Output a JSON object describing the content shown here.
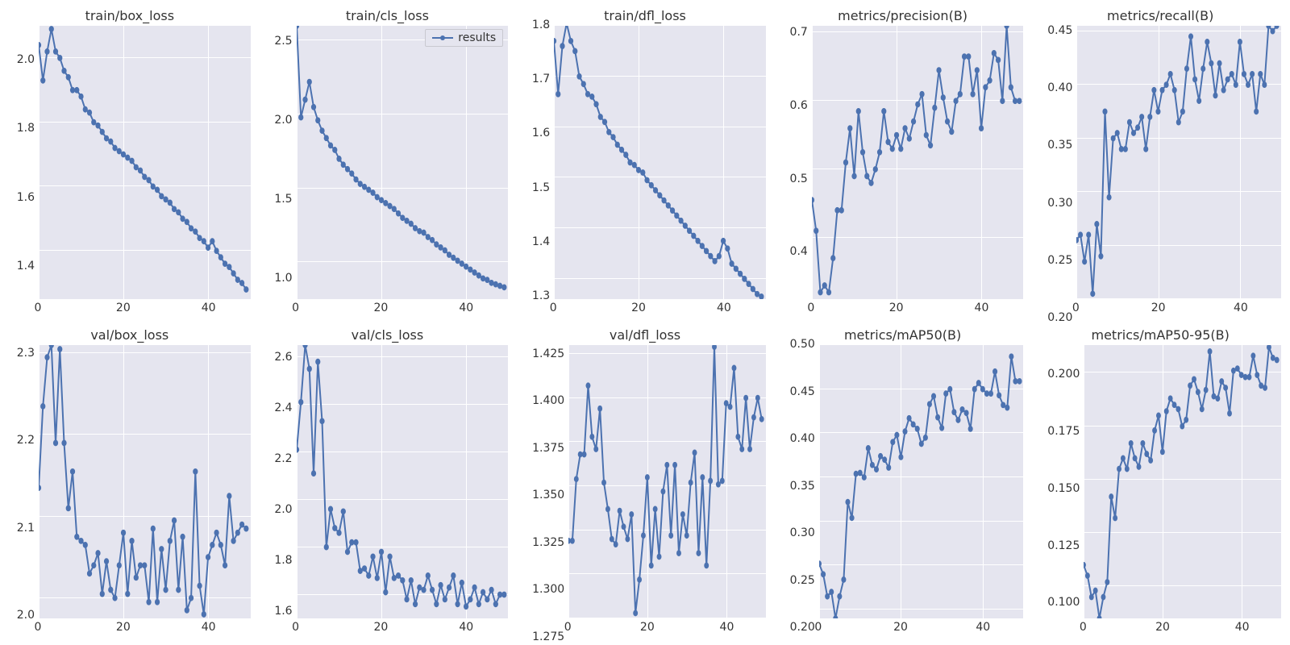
{
  "legend_label": "results",
  "chart_data": [
    {
      "id": "train_box_loss",
      "title": "train/box_loss",
      "type": "line",
      "xlabel": "",
      "ylabel": "",
      "xlim": [
        0,
        50
      ],
      "ylim": [
        1.25,
        2.1
      ],
      "xticks": [
        0,
        20,
        40
      ],
      "yticks": [
        1.4,
        1.6,
        1.8,
        2.0
      ],
      "legend_here": false,
      "values": [
        2.04,
        1.93,
        2.02,
        2.09,
        2.02,
        2.0,
        1.96,
        1.94,
        1.9,
        1.9,
        1.88,
        1.84,
        1.83,
        1.8,
        1.79,
        1.77,
        1.75,
        1.74,
        1.72,
        1.71,
        1.7,
        1.69,
        1.68,
        1.66,
        1.65,
        1.63,
        1.62,
        1.6,
        1.59,
        1.57,
        1.56,
        1.55,
        1.53,
        1.52,
        1.5,
        1.49,
        1.47,
        1.46,
        1.44,
        1.43,
        1.41,
        1.43,
        1.4,
        1.38,
        1.36,
        1.35,
        1.33,
        1.31,
        1.3,
        1.28
      ]
    },
    {
      "id": "train_cls_loss",
      "title": "train/cls_loss",
      "type": "line",
      "xlabel": "",
      "ylabel": "",
      "xlim": [
        0,
        50
      ],
      "ylim": [
        0.75,
        2.6
      ],
      "xticks": [
        0,
        20,
        40
      ],
      "yticks": [
        1.0,
        1.5,
        2.0,
        2.5
      ],
      "legend_here": true,
      "values": [
        2.6,
        1.98,
        2.1,
        2.22,
        2.05,
        1.96,
        1.89,
        1.84,
        1.79,
        1.76,
        1.7,
        1.66,
        1.63,
        1.6,
        1.56,
        1.53,
        1.51,
        1.49,
        1.47,
        1.44,
        1.42,
        1.4,
        1.38,
        1.36,
        1.33,
        1.3,
        1.28,
        1.26,
        1.23,
        1.21,
        1.2,
        1.17,
        1.15,
        1.12,
        1.1,
        1.08,
        1.05,
        1.03,
        1.01,
        0.99,
        0.97,
        0.95,
        0.93,
        0.91,
        0.89,
        0.88,
        0.86,
        0.85,
        0.84,
        0.83
      ]
    },
    {
      "id": "train_dfl_loss",
      "title": "train/dfl_loss",
      "type": "line",
      "xlabel": "",
      "ylabel": "",
      "xlim": [
        0,
        50
      ],
      "ylim": [
        1.26,
        1.8
      ],
      "xticks": [
        0,
        20,
        40
      ],
      "yticks": [
        1.3,
        1.4,
        1.5,
        1.6,
        1.7,
        1.8
      ],
      "legend_here": false,
      "values": [
        1.77,
        1.665,
        1.76,
        1.805,
        1.77,
        1.75,
        1.7,
        1.685,
        1.665,
        1.66,
        1.645,
        1.62,
        1.61,
        1.59,
        1.58,
        1.565,
        1.555,
        1.545,
        1.53,
        1.525,
        1.515,
        1.51,
        1.495,
        1.485,
        1.475,
        1.465,
        1.455,
        1.445,
        1.435,
        1.425,
        1.415,
        1.405,
        1.395,
        1.385,
        1.375,
        1.365,
        1.355,
        1.345,
        1.335,
        1.345,
        1.375,
        1.36,
        1.33,
        1.32,
        1.31,
        1.3,
        1.29,
        1.28,
        1.27,
        1.265
      ]
    },
    {
      "id": "metrics_precision",
      "title": "metrics/precision(B)",
      "type": "line",
      "xlabel": "",
      "ylabel": "",
      "xlim": [
        0,
        50
      ],
      "ylim": [
        0.31,
        0.71
      ],
      "xticks": [
        0,
        20,
        40
      ],
      "yticks": [
        0.4,
        0.5,
        0.6,
        0.7
      ],
      "legend_here": false,
      "values": [
        0.455,
        0.41,
        0.32,
        0.33,
        0.32,
        0.37,
        0.44,
        0.44,
        0.51,
        0.56,
        0.49,
        0.585,
        0.525,
        0.49,
        0.48,
        0.5,
        0.525,
        0.585,
        0.54,
        0.53,
        0.55,
        0.53,
        0.56,
        0.545,
        0.57,
        0.595,
        0.61,
        0.55,
        0.535,
        0.59,
        0.645,
        0.605,
        0.57,
        0.555,
        0.6,
        0.61,
        0.665,
        0.665,
        0.61,
        0.645,
        0.56,
        0.62,
        0.63,
        0.67,
        0.66,
        0.6,
        0.71,
        0.62,
        0.6,
        0.6
      ]
    },
    {
      "id": "metrics_recall",
      "title": "metrics/recall(B)",
      "type": "line",
      "xlabel": "",
      "ylabel": "",
      "xlim": [
        0,
        50
      ],
      "ylim": [
        0.2,
        0.455
      ],
      "xticks": [
        0,
        20,
        40
      ],
      "yticks": [
        0.2,
        0.25,
        0.3,
        0.35,
        0.4,
        0.45
      ],
      "legend_here": false,
      "values": [
        0.255,
        0.26,
        0.235,
        0.26,
        0.205,
        0.27,
        0.24,
        0.375,
        0.295,
        0.35,
        0.355,
        0.34,
        0.34,
        0.365,
        0.355,
        0.36,
        0.37,
        0.34,
        0.37,
        0.395,
        0.375,
        0.395,
        0.4,
        0.41,
        0.395,
        0.365,
        0.375,
        0.415,
        0.445,
        0.405,
        0.385,
        0.415,
        0.44,
        0.42,
        0.39,
        0.42,
        0.395,
        0.405,
        0.41,
        0.4,
        0.44,
        0.41,
        0.4,
        0.41,
        0.375,
        0.41,
        0.4,
        0.455,
        0.45,
        0.455
      ]
    },
    {
      "id": "val_box_loss",
      "title": "val/box_loss",
      "type": "line",
      "xlabel": "",
      "ylabel": "",
      "xlim": [
        0,
        50
      ],
      "ylim": [
        1.975,
        2.31
      ],
      "xticks": [
        0,
        20,
        40
      ],
      "yticks": [
        2.0,
        2.1,
        2.2,
        2.3
      ],
      "legend_here": false,
      "values": [
        2.135,
        2.235,
        2.295,
        2.31,
        2.19,
        2.305,
        2.19,
        2.11,
        2.155,
        2.075,
        2.07,
        2.065,
        2.03,
        2.04,
        2.055,
        2.005,
        2.045,
        2.01,
        2.0,
        2.04,
        2.08,
        2.005,
        2.07,
        2.025,
        2.04,
        2.04,
        1.995,
        2.085,
        1.995,
        2.06,
        2.01,
        2.07,
        2.095,
        2.01,
        2.075,
        1.985,
        2.0,
        2.155,
        2.015,
        1.98,
        2.05,
        2.065,
        2.08,
        2.065,
        2.04,
        2.125,
        2.07,
        2.08,
        2.09,
        2.085
      ]
    },
    {
      "id": "val_cls_loss",
      "title": "val/cls_loss",
      "type": "line",
      "xlabel": "",
      "ylabel": "",
      "xlim": [
        0,
        50
      ],
      "ylim": [
        1.5,
        2.65
      ],
      "xticks": [
        0,
        20,
        40
      ],
      "yticks": [
        1.6,
        1.8,
        2.0,
        2.2,
        2.4,
        2.6
      ],
      "legend_here": false,
      "values": [
        2.21,
        2.41,
        2.65,
        2.55,
        2.11,
        2.58,
        2.33,
        1.8,
        1.96,
        1.88,
        1.86,
        1.95,
        1.78,
        1.82,
        1.82,
        1.7,
        1.71,
        1.68,
        1.76,
        1.67,
        1.78,
        1.61,
        1.76,
        1.67,
        1.68,
        1.66,
        1.58,
        1.66,
        1.56,
        1.63,
        1.62,
        1.68,
        1.62,
        1.56,
        1.64,
        1.58,
        1.63,
        1.68,
        1.56,
        1.65,
        1.55,
        1.58,
        1.63,
        1.56,
        1.61,
        1.58,
        1.62,
        1.56,
        1.6,
        1.6
      ]
    },
    {
      "id": "val_dfl_loss",
      "title": "val/dfl_loss",
      "type": "line",
      "xlabel": "",
      "ylabel": "",
      "xlim": [
        0,
        50
      ],
      "ylim": [
        1.275,
        1.43
      ],
      "xticks": [
        0,
        20,
        40
      ],
      "yticks": [
        1.275,
        1.3,
        1.325,
        1.35,
        1.375,
        1.4,
        1.425
      ],
      "legend_here": false,
      "values": [
        1.319,
        1.319,
        1.354,
        1.368,
        1.368,
        1.407,
        1.378,
        1.371,
        1.394,
        1.352,
        1.337,
        1.32,
        1.317,
        1.336,
        1.327,
        1.32,
        1.334,
        1.278,
        1.297,
        1.322,
        1.355,
        1.305,
        1.337,
        1.31,
        1.347,
        1.362,
        1.322,
        1.362,
        1.312,
        1.334,
        1.322,
        1.352,
        1.369,
        1.312,
        1.355,
        1.305,
        1.353,
        1.429,
        1.351,
        1.353,
        1.397,
        1.395,
        1.417,
        1.378,
        1.371,
        1.4,
        1.371,
        1.389,
        1.4,
        1.388
      ]
    },
    {
      "id": "metrics_map50",
      "title": "metrics/mAP50(B)",
      "type": "line",
      "xlabel": "",
      "ylabel": "",
      "xlim": [
        0,
        50
      ],
      "ylim": [
        0.19,
        0.5
      ],
      "xticks": [
        0,
        20,
        40
      ],
      "yticks": [
        0.2,
        0.25,
        0.3,
        0.35,
        0.4,
        0.45,
        0.5
      ],
      "legend_here": false,
      "values": [
        0.252,
        0.24,
        0.215,
        0.22,
        0.19,
        0.215,
        0.234,
        0.322,
        0.304,
        0.354,
        0.355,
        0.35,
        0.383,
        0.364,
        0.359,
        0.374,
        0.37,
        0.361,
        0.39,
        0.398,
        0.373,
        0.402,
        0.417,
        0.41,
        0.405,
        0.388,
        0.395,
        0.433,
        0.442,
        0.418,
        0.406,
        0.445,
        0.45,
        0.424,
        0.415,
        0.427,
        0.423,
        0.405,
        0.45,
        0.457,
        0.45,
        0.445,
        0.445,
        0.47,
        0.443,
        0.432,
        0.429,
        0.487,
        0.459,
        0.459
      ]
    },
    {
      "id": "metrics_map5095",
      "title": "metrics/mAP50-95(B)",
      "type": "line",
      "xlabel": "",
      "ylabel": "",
      "xlim": [
        0,
        50
      ],
      "ylim": [
        0.085,
        0.213
      ],
      "xticks": [
        0,
        20,
        40
      ],
      "yticks": [
        0.1,
        0.125,
        0.15,
        0.175,
        0.2
      ],
      "legend_here": false,
      "values": [
        0.11,
        0.105,
        0.095,
        0.098,
        0.085,
        0.095,
        0.102,
        0.142,
        0.132,
        0.155,
        0.16,
        0.155,
        0.167,
        0.16,
        0.156,
        0.167,
        0.162,
        0.159,
        0.173,
        0.18,
        0.163,
        0.182,
        0.188,
        0.185,
        0.183,
        0.175,
        0.178,
        0.194,
        0.197,
        0.191,
        0.183,
        0.192,
        0.21,
        0.189,
        0.188,
        0.196,
        0.193,
        0.181,
        0.201,
        0.202,
        0.199,
        0.198,
        0.198,
        0.208,
        0.199,
        0.194,
        0.193,
        0.212,
        0.207,
        0.206
      ]
    }
  ]
}
